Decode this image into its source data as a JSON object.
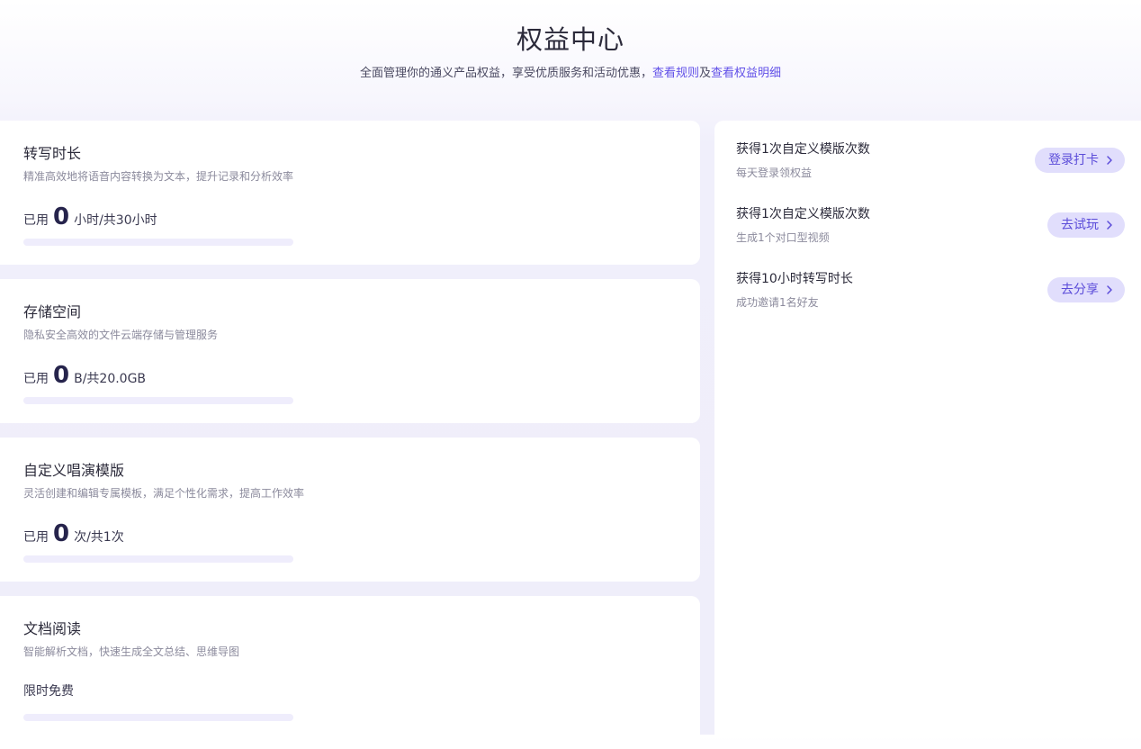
{
  "header": {
    "title": "权益中心",
    "subtitle_text": "全面管理你的通义产品权益，享受优质服务和活动优惠，",
    "rules_link": "查看规则",
    "joiner": "及",
    "details_link": "查看权益明细"
  },
  "benefits": [
    {
      "title": "转写时长",
      "desc": "精准高效地将语音内容转换为文本，提升记录和分析效率",
      "used_prefix": "已用",
      "used_value": "0",
      "used_suffix": "小时/共30小时",
      "progress": 0
    },
    {
      "title": "存储空间",
      "desc": "隐私安全高效的文件云端存储与管理服务",
      "used_prefix": "已用",
      "used_value": "0",
      "used_suffix": "B/共20.0GB",
      "progress": 0
    },
    {
      "title": "自定义唱演模版",
      "desc": "灵活创建和编辑专属模板，满足个性化需求，提高工作效率",
      "used_prefix": "已用",
      "used_value": "0",
      "used_suffix": "次/共1次",
      "progress": 0
    },
    {
      "title": "文档阅读",
      "desc": "智能解析文档，快速生成全文总结、思维导图",
      "free_label": "限时免费",
      "progress": 0
    }
  ],
  "tasks": [
    {
      "title": "获得1次自定义模版次数",
      "desc": "每天登录领权益",
      "button": "登录打卡"
    },
    {
      "title": "获得1次自定义模版次数",
      "desc": "生成1个对口型视频",
      "button": "去试玩"
    },
    {
      "title": "获得10小时转写时长",
      "desc": "成功邀请1名好友",
      "button": "去分享"
    }
  ],
  "colors": {
    "accent": "#6150e8",
    "button_bg": "#e1defc",
    "track": "#efedfc"
  },
  "icons": {
    "task_button": "chevron-right-icon"
  }
}
